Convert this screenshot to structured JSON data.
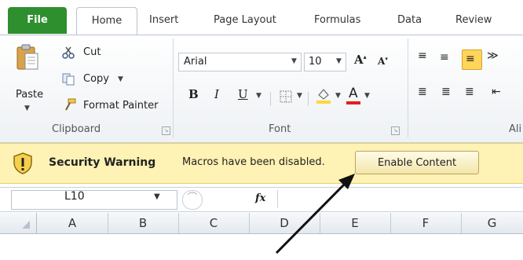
{
  "tabs": [
    "File",
    "Home",
    "Insert",
    "Page Layout",
    "Formulas",
    "Data",
    "Review"
  ],
  "clipboard": {
    "paste": "Paste",
    "cut": "Cut",
    "copy": "Copy",
    "format_painter": "Format Painter",
    "label": "Clipboard"
  },
  "font": {
    "name": "Arial",
    "size": "10",
    "label": "Font"
  },
  "alignment": {
    "label_partial": "Ali"
  },
  "security_bar": {
    "title": "Security Warning",
    "message": "Macros have been disabled.",
    "button": "Enable Content"
  },
  "formula_bar": {
    "name_box": "L10",
    "fx": "fx"
  },
  "columns": [
    "A",
    "B",
    "C",
    "D",
    "E",
    "F",
    "G"
  ],
  "colors": {
    "file_tab": "#2e8f2e",
    "security_bar": "#fef2b4",
    "font_color_bar": "#e01f1f",
    "highlight_bar": "#ffd83a"
  }
}
